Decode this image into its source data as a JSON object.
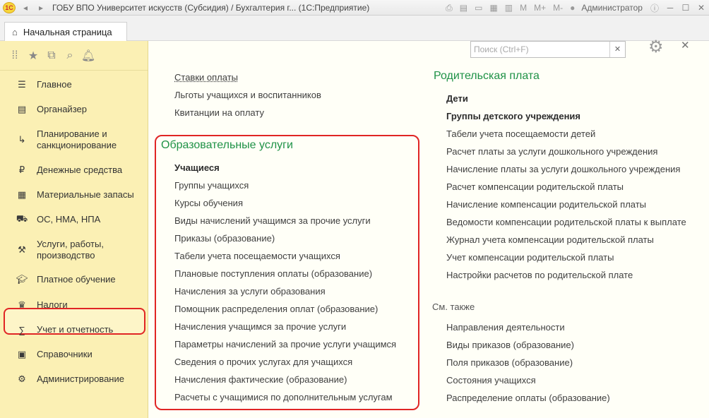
{
  "window": {
    "title": "ГОБУ ВПО Университет искусств (Субсидия) / Бухгалтерия г...  (1С:Предприятие)",
    "user": "Администратор",
    "memory_buttons": [
      "M",
      "M+",
      "M-"
    ]
  },
  "tabs": {
    "home_label": "Начальная страница"
  },
  "sidebar": {
    "items": [
      {
        "label": "Главное",
        "icon": "menu-icon"
      },
      {
        "label": "Органайзер",
        "icon": "clipboard-icon"
      },
      {
        "label": "Планирование и санкционирование",
        "icon": "chart-icon"
      },
      {
        "label": "Денежные средства",
        "icon": "ruble-icon"
      },
      {
        "label": "Материальные запасы",
        "icon": "grid-icon"
      },
      {
        "label": "ОС, НМА, НПА",
        "icon": "truck-icon"
      },
      {
        "label": "Услуги, работы, производство",
        "icon": "tools-icon"
      },
      {
        "label": "Платное обучение",
        "icon": "graduation-cap-icon"
      },
      {
        "label": "Налоги",
        "icon": "emblem-icon"
      },
      {
        "label": "Учет и отчетность",
        "icon": "sum-icon"
      },
      {
        "label": "Справочники",
        "icon": "book-icon"
      },
      {
        "label": "Администрирование",
        "icon": "gear-icon"
      }
    ],
    "active_index": 7
  },
  "search": {
    "placeholder": "Поиск (Ctrl+F)"
  },
  "main": {
    "top_links": [
      "Ставки оплаты",
      "Льготы учащихся и воспитанников",
      "Квитанции на оплату"
    ],
    "edu_section": {
      "title": "Образовательные услуги",
      "links": [
        "Учащиеся",
        "Группы учащихся",
        "Курсы обучения",
        "Виды начислений учащимся за прочие услуги",
        "Приказы (образование)",
        "Табели учета посещаемости учащихся",
        "Плановые поступления оплаты (образование)",
        "Начисления за услуги образования",
        "Помощник распределения оплат (образование)",
        "Начисления учащимся за прочие услуги",
        "Параметры начислений за прочие услуги учащимся",
        "Сведения о прочих услугах для учащихся",
        "Начисления фактические (образование)",
        "Расчеты с учащимися по дополнительным услугам"
      ]
    },
    "parent_section": {
      "title": "Родительская плата",
      "links": [
        "Дети",
        "Группы детского учреждения",
        "Табели учета посещаемости детей",
        "Расчет платы за услуги дошкольного учреждения",
        "Начисление платы за услуги дошкольного учреждения",
        "Расчет компенсации родительской платы",
        "Начисление компенсации родительской платы",
        "Ведомости компенсации родительской платы к выплате",
        "Журнал учета компенсации родительской платы",
        "Учет компенсации родительской платы",
        "Настройки расчетов по родительской плате"
      ]
    },
    "see_also": {
      "title": "См. также",
      "links": [
        "Направления деятельности",
        "Виды приказов (образование)",
        "Поля приказов (образование)",
        "Состояния учащихся",
        "Распределение оплаты (образование)"
      ]
    }
  },
  "colors": {
    "sidebar_bg": "#fbf0b4",
    "section_title": "#1f9247",
    "highlight": "#e02525"
  }
}
